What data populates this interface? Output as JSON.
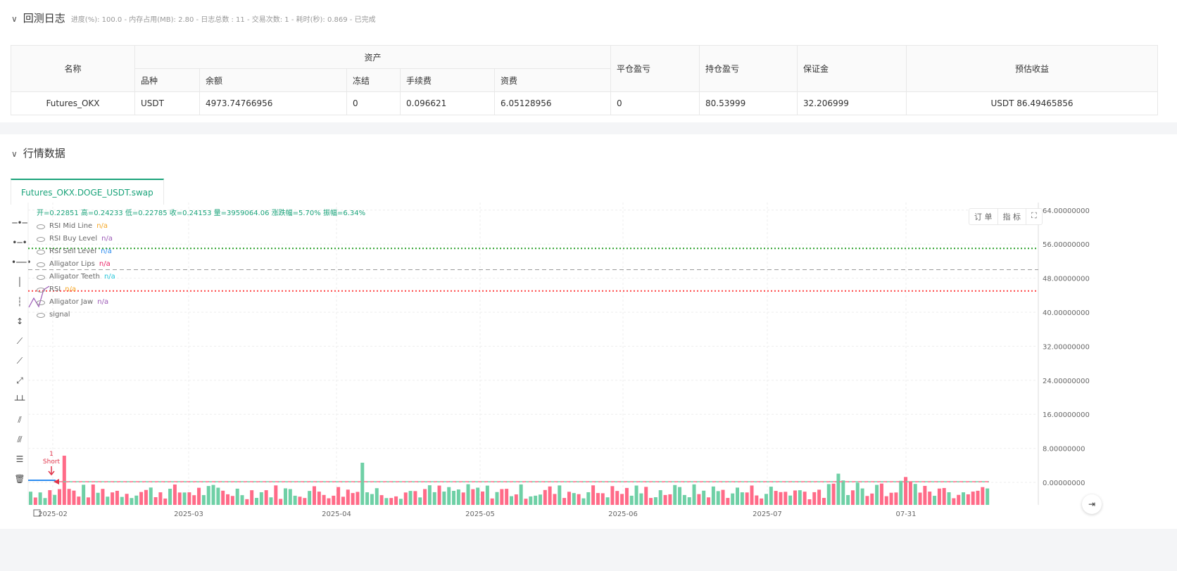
{
  "log": {
    "title": "回测日志",
    "summary": "进度(%): 100.0 - 内存占用(MB): 2.80 - 日志总数 : 11 - 交易次数: 1 - 耗时(秒): 0.869 - 已完成"
  },
  "table": {
    "h_name": "名称",
    "h_assets": "资产",
    "h_close_pnl": "平仓盈亏",
    "h_pos_pnl": "持仓盈亏",
    "h_margin": "保证金",
    "h_est": "预估收益",
    "sub": [
      "品种",
      "余额",
      "冻结",
      "手续费",
      "资费"
    ],
    "row": [
      "Futures_OKX",
      "USDT",
      "4973.74766956",
      "0",
      "0.096621",
      "6.05128956",
      "0",
      "80.53999",
      "32.206999",
      "USDT 86.49465856"
    ]
  },
  "market": {
    "title": "行情数据",
    "tab": "Futures_OKX.DOGE_USDT.swap"
  },
  "chart": {
    "ohlc": "开=0.22851 高=0.24233 低=0.22785 收=0.24153 量=3959064.06 涨跌幅=5.70% 振幅=6.34%",
    "legend": [
      {
        "name": "RSI Mid Line",
        "v": "n/a",
        "c": "#f5a623"
      },
      {
        "name": "RSI Buy Level",
        "v": "n/a",
        "c": "#9b59b6"
      },
      {
        "name": "RSI Sell Level",
        "v": "n/a",
        "c": "#2d8cf0"
      },
      {
        "name": "Alligator Lips",
        "v": "n/a",
        "c": "#e91e63"
      },
      {
        "name": "Alligator Teeth",
        "v": "n/a",
        "c": "#26c6da"
      },
      {
        "name": "RSI",
        "v": "n/a",
        "c": "#f5a623"
      },
      {
        "name": "Alligator Jaw",
        "v": "n/a",
        "c": "#9b59b6"
      },
      {
        "name": "signal",
        "v": "",
        "c": "#999"
      }
    ],
    "buttons": [
      "订 单",
      "指 标"
    ],
    "y_ticks": [
      "64.00000000",
      "56.00000000",
      "48.00000000",
      "40.00000000",
      "32.00000000",
      "24.00000000",
      "16.00000000",
      "8.00000000",
      "0.00000000"
    ],
    "x_ticks": [
      "2025-02",
      "2025-03",
      "2025-04",
      "2025-05",
      "2025-06",
      "2025-07",
      "07-31"
    ],
    "marker": {
      "count": "1",
      "label": "Short"
    },
    "colors": {
      "up": "#6fd0a6",
      "down": "#ff6b88",
      "sell_level": "#2ca02c",
      "buy_level": "#ff4040"
    },
    "levels": {
      "sell": 55,
      "mid": 50,
      "buy": 45
    }
  }
}
